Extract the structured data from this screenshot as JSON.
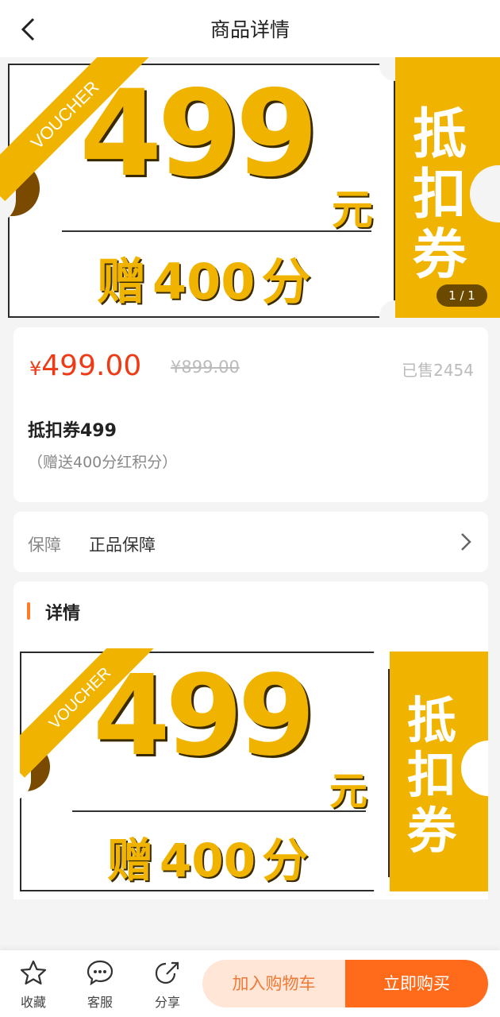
{
  "header": {
    "title": "商品详情"
  },
  "banner": {
    "ribbon": "VOUCHER",
    "amount": "499",
    "unit": "元",
    "gift_prefix": "赠",
    "gift_value": "400",
    "gift_unit": "分",
    "side_text": "抵扣券",
    "pager": "1 / 1"
  },
  "product": {
    "currency": "¥",
    "price": "499.00",
    "original_price": "¥899.00",
    "sold": "已售2454",
    "name": "抵扣券499",
    "note": "（赠送400分红积分）"
  },
  "guarantee": {
    "label": "保障",
    "value": "正品保障"
  },
  "detail": {
    "title": "详情",
    "ribbon": "VOUCHER",
    "amount": "499",
    "unit": "元",
    "gift_prefix": "赠",
    "gift_value": "400",
    "gift_unit": "分",
    "side_text": "抵扣券"
  },
  "bottom": {
    "favorite": "收藏",
    "service": "客服",
    "share": "分享",
    "add_to_cart": "加入购物车",
    "buy_now": "立即购买"
  },
  "colors": {
    "voucher_gold": "#f0b400",
    "price_red": "#ee3b15",
    "buy_orange": "#ff6b1a",
    "cart_bg": "#ffe6d6"
  },
  "icons": [
    "back-arrow-icon",
    "chevron-right-icon",
    "star-icon",
    "chat-icon",
    "share-icon"
  ]
}
